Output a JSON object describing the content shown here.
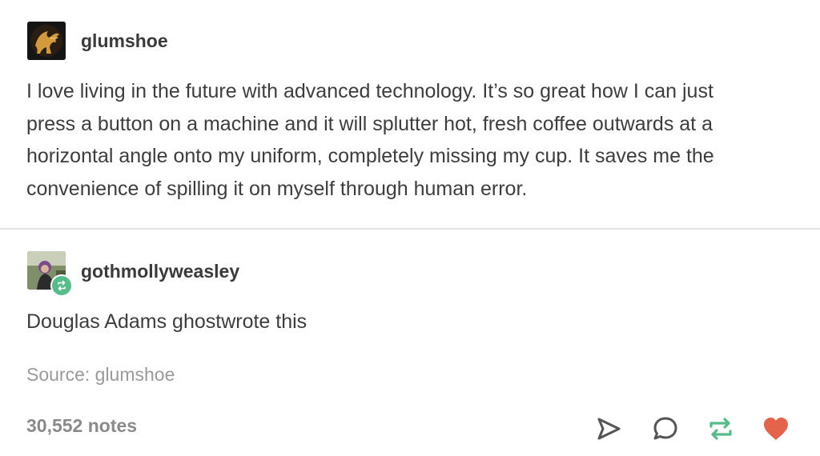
{
  "posts": [
    {
      "username": "glumshoe",
      "avatar_icon": "griffin-logo-icon",
      "body_lines": [
        "I love living in the future with advanced technology. It’s so great how I can just",
        "press a button on a machine and it will splutter hot, fresh coffee outwards at a",
        "horizontal angle onto my uniform, completely missing my cup. It saves me the",
        "convenience of spilling it on myself through human error."
      ]
    },
    {
      "username": "gothmollyweasley",
      "avatar_icon": "user-photo-avatar",
      "badge_icon": "reblog-icon",
      "body": "Douglas Adams ghostwrote this"
    }
  ],
  "source": "Source: glumshoe",
  "footer": {
    "notes": "30,552 notes",
    "actions": [
      {
        "icon": "share-icon",
        "color": "#555555"
      },
      {
        "icon": "reply-icon",
        "color": "#555555"
      },
      {
        "icon": "reblog-icon",
        "color": "#56bc8a"
      },
      {
        "icon": "heart-icon",
        "color": "#e4634b"
      }
    ]
  },
  "colors": {
    "text": "#3d3d3d",
    "muted": "#9a9a9a",
    "reblog_green": "#56bc8a",
    "heart_red": "#e4634b",
    "divider": "#e3e3e3"
  }
}
